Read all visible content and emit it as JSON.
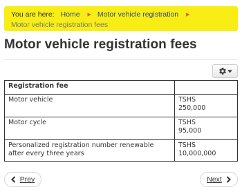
{
  "breadcrumb": {
    "prefix": "You are here:",
    "items": [
      "Home",
      "Motor vehicle registration"
    ],
    "current": "Motor vehicle registration fees"
  },
  "page": {
    "title": "Motor vehicle registration fees"
  },
  "toolbar": {
    "gear_icon": "gear-icon",
    "caret_icon": "caret-down-icon"
  },
  "table": {
    "headers": [
      "Registration fee",
      ""
    ],
    "rows": [
      {
        "item": "Motor vehicle",
        "fee": "TSHS\n250,000"
      },
      {
        "item": "Motor cycle",
        "fee": "TSHS\n95,000"
      },
      {
        "item": "Personalized registration number renewable after every three years",
        "fee": "TSHS\n10,000,000"
      }
    ]
  },
  "pager": {
    "prev_label": "Prev",
    "next_label": "Next"
  },
  "colors": {
    "breadcrumb_bg": "#f8ee16",
    "link": "#2d4b7e",
    "separator": "#e05a2b"
  }
}
